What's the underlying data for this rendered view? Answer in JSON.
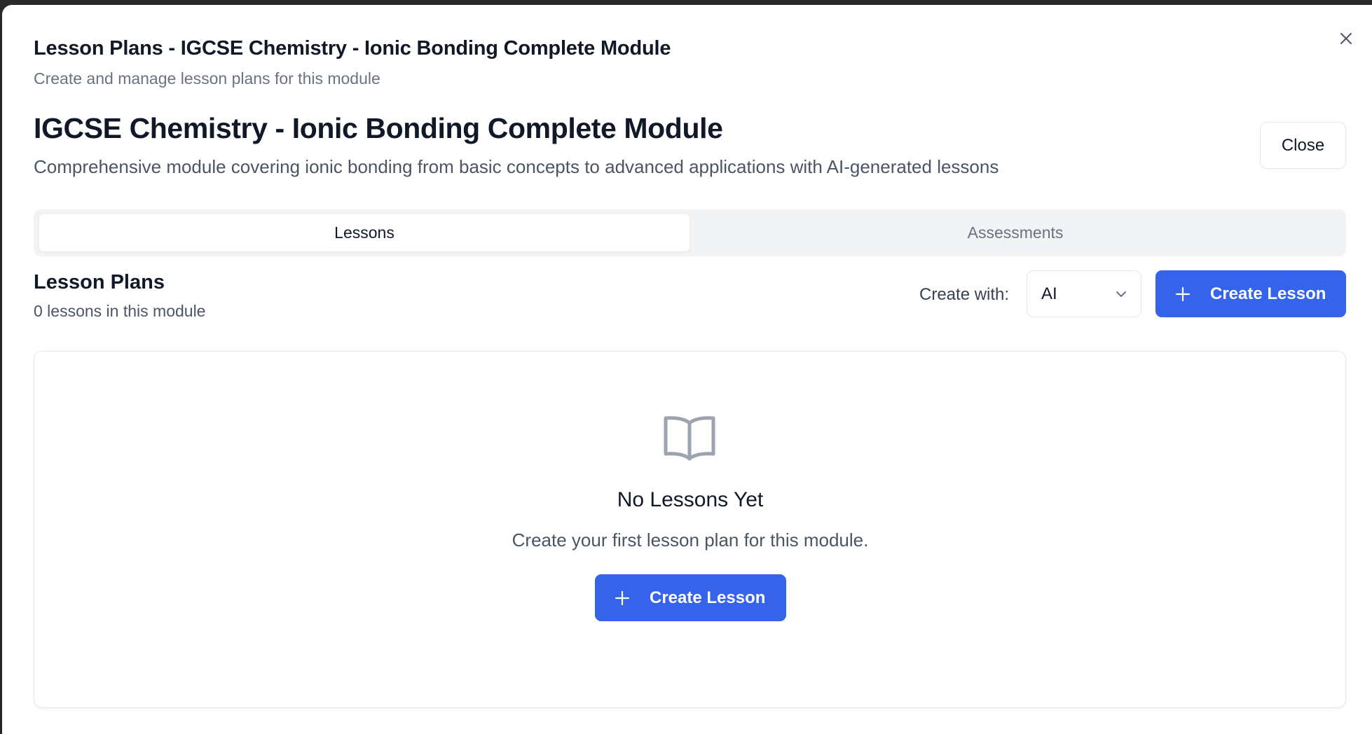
{
  "dialog": {
    "title": "Lesson Plans - IGCSE Chemistry - Ionic Bonding Complete Module",
    "description": "Create and manage lesson plans for this module",
    "close_icon": "close-icon"
  },
  "module": {
    "title": "IGCSE Chemistry - Ionic Bonding Complete Module",
    "description": "Comprehensive module covering ionic bonding from basic concepts to advanced applications with AI-generated lessons",
    "close_label": "Close"
  },
  "tabs": [
    {
      "label": "Lessons",
      "active": true
    },
    {
      "label": "Assessments",
      "active": false
    }
  ],
  "lessons_section": {
    "title": "Lesson Plans",
    "count_text": "0 lessons in this module",
    "create_with_label": "Create with:",
    "create_with_selected": "AI",
    "create_button_label": "Create Lesson"
  },
  "empty_state": {
    "icon": "book-open-icon",
    "title": "No Lessons Yet",
    "description": "Create your first lesson plan for this module.",
    "button_label": "Create Lesson"
  },
  "colors": {
    "primary": "#3563e9",
    "tab_bg": "#f1f3f5",
    "muted_text": "#6b7280"
  }
}
